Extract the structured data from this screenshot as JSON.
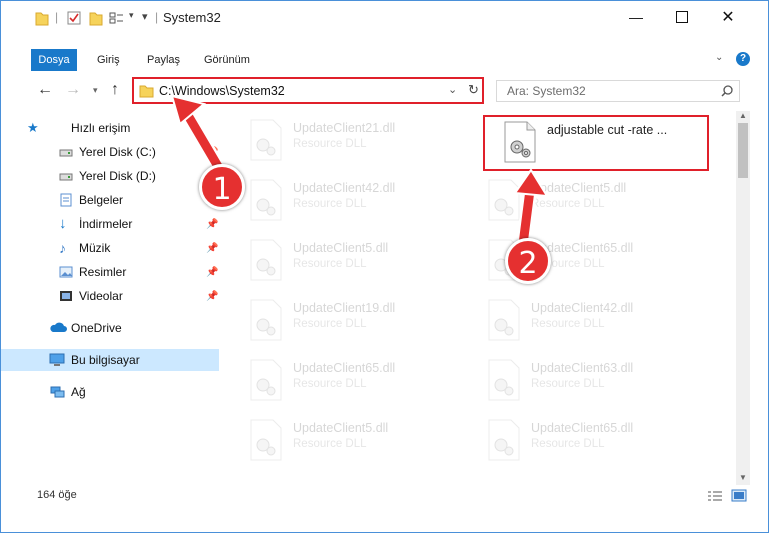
{
  "window": {
    "title": "System32"
  },
  "ribbon": {
    "tabs": [
      {
        "label": "Dosya"
      },
      {
        "label": "Giriş"
      },
      {
        "label": "Paylaş"
      },
      {
        "label": "Görünüm"
      }
    ]
  },
  "address": {
    "path": "C:\\Windows\\System32"
  },
  "search": {
    "placeholder": "Ara: System32"
  },
  "sidebar": {
    "items": [
      {
        "label": "Hızlı erişim"
      },
      {
        "label": "Yerel Disk (C:)"
      },
      {
        "label": "Yerel Disk (D:)"
      },
      {
        "label": "Belgeler"
      },
      {
        "label": "İndirmeler"
      },
      {
        "label": "Müzik"
      },
      {
        "label": "Resimler"
      },
      {
        "label": "Videolar"
      },
      {
        "label": "OneDrive"
      },
      {
        "label": "Bu bilgisayar"
      },
      {
        "label": "Ağ"
      }
    ]
  },
  "files": [
    {
      "name": "UpdateClient21.dll",
      "type": "Resource DLL"
    },
    {
      "name": "adjustable cut -rate ...",
      "type": ""
    },
    {
      "name": "UpdateClient42.dll",
      "type": "Resource DLL"
    },
    {
      "name": "UpdateClient5.dll",
      "type": "Resource DLL"
    },
    {
      "name": "UpdateClient5.dll",
      "type": "Resource DLL"
    },
    {
      "name": "UpdateClient65.dll",
      "type": "Resource DLL"
    },
    {
      "name": "UpdateClient19.dll",
      "type": "Resource DLL"
    },
    {
      "name": "UpdateClient42.dll",
      "type": "Resource DLL"
    },
    {
      "name": "UpdateClient65.dll",
      "type": "Resource DLL"
    },
    {
      "name": "UpdateClient63.dll",
      "type": "Resource DLL"
    },
    {
      "name": "UpdateClient5.dll",
      "type": "Resource DLL"
    },
    {
      "name": "UpdateClient65.dll",
      "type": "Resource DLL"
    }
  ],
  "status": {
    "count": "164 öğe"
  },
  "callouts": [
    {
      "label": "1"
    },
    {
      "label": "2"
    }
  ],
  "colors": {
    "accent": "#1979ca",
    "highlight": "#e0202a",
    "selected": "#cce8ff"
  }
}
